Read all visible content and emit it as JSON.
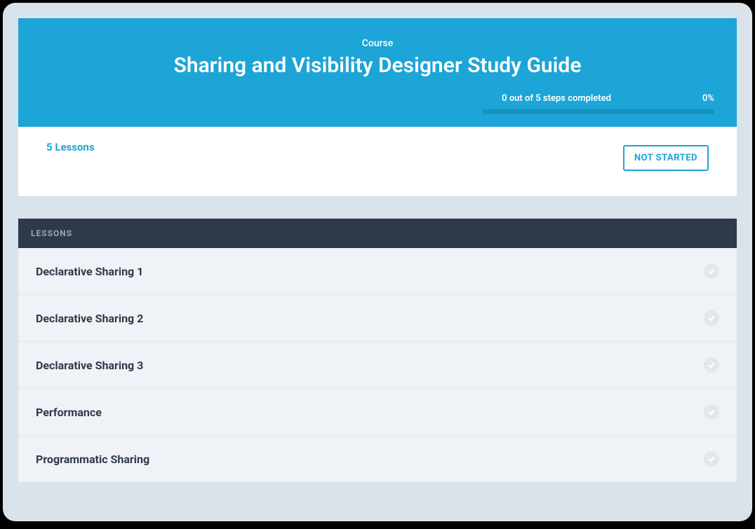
{
  "header": {
    "label": "Course",
    "title": "Sharing and Visibility Designer Study Guide",
    "progress_text": "0 out of 5 steps completed",
    "progress_percent": "0%"
  },
  "summary": {
    "lessons_count": "5 Lessons",
    "status": "NOT STARTED"
  },
  "lessons_header": "LESSONS",
  "lessons": [
    {
      "title": "Declarative Sharing 1"
    },
    {
      "title": "Declarative Sharing 2"
    },
    {
      "title": "Declarative Sharing 3"
    },
    {
      "title": "Performance"
    },
    {
      "title": "Programmatic Sharing"
    }
  ]
}
